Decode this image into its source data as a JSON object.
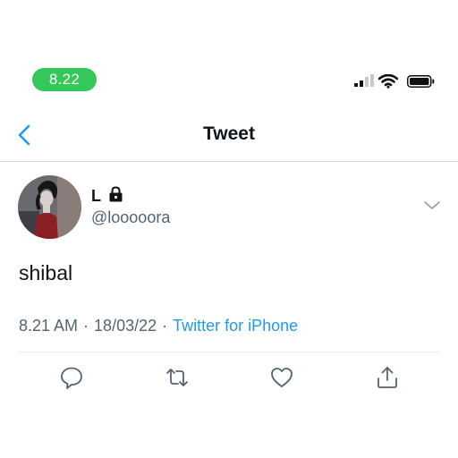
{
  "status_bar": {
    "time": "8.22",
    "time_pill_color": "#34c759",
    "icons": [
      "signal-bars-icon",
      "wifi-icon",
      "battery-icon"
    ]
  },
  "header": {
    "title": "Tweet",
    "back_icon": "chevron-left-icon",
    "accent_color": "#1d9bf0"
  },
  "tweet": {
    "display_name": "L",
    "protected_icon": "lock-icon",
    "handle": "@looooora",
    "text": "shibal",
    "time": "8.21 AM",
    "date": "18/03/22",
    "separator": "·",
    "source": "Twitter for iPhone",
    "more_icon": "chevron-down-icon"
  },
  "actions": [
    {
      "name": "reply",
      "icon": "speech-bubble-icon"
    },
    {
      "name": "retweet",
      "icon": "retweet-arrows-icon"
    },
    {
      "name": "like",
      "icon": "heart-icon"
    },
    {
      "name": "share",
      "icon": "share-upload-icon"
    }
  ]
}
